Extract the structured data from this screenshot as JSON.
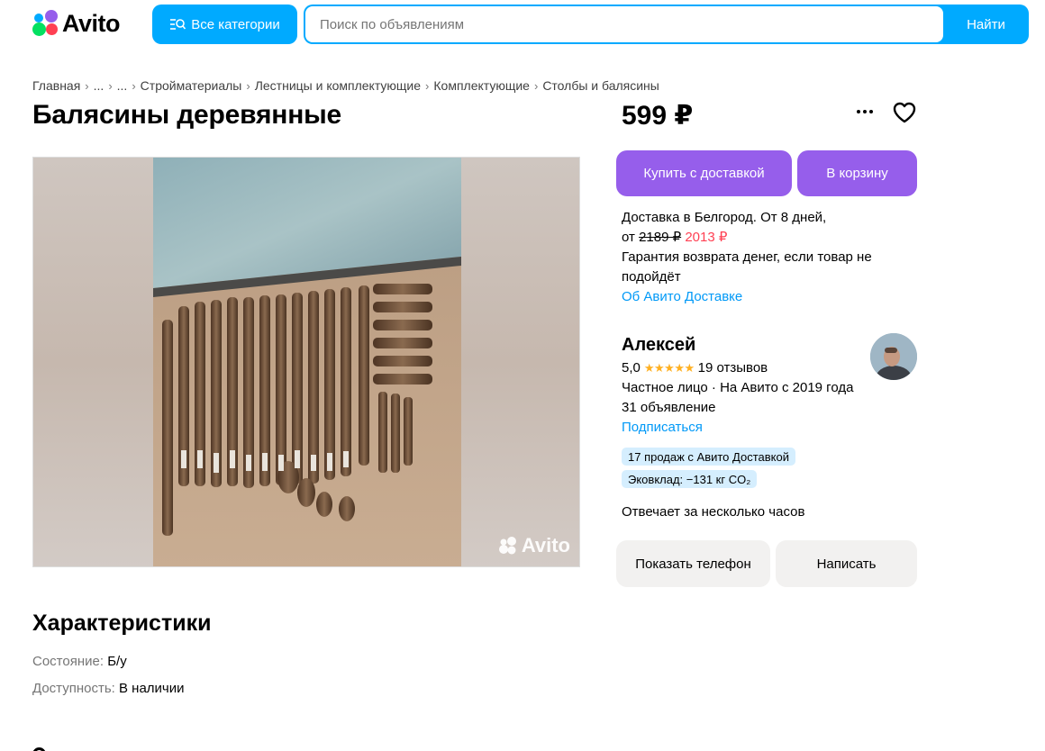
{
  "header": {
    "logo_text": "Avito",
    "categories_label": "Все категории",
    "search_placeholder": "Поиск по объявлениям",
    "search_button": "Найти"
  },
  "breadcrumb": [
    "Главная",
    "...",
    "...",
    "Стройматериалы",
    "Лестницы и комплектующие",
    "Комплектующие",
    "Столбы и балясины"
  ],
  "listing": {
    "title": "Балясины деревянные",
    "price": "599 ₽",
    "watermark": "Avito"
  },
  "actions": {
    "buy_label": "Купить с доставкой",
    "cart_label": "В корзину"
  },
  "delivery": {
    "line1": "Доставка в Белгород. От 8 дней,",
    "from": "от",
    "old_price": "2189 ₽",
    "new_price": "2013 ₽",
    "guarantee": "Гарантия возврата денег, если товар не подойдёт",
    "link": "Об Авито Доставке"
  },
  "seller": {
    "name": "Алексей",
    "rating": "5,0",
    "stars": "★★★★★",
    "reviews": "19 отзывов",
    "type": "Частное лицо · На Авито с 2019 года",
    "ads": "31 объявление",
    "subscribe": "Подписаться",
    "badge_sales": "17 продаж с Авито Доставкой",
    "badge_eco": "Эковклад: −131 кг CO₂",
    "responds": "Отвечает за несколько часов",
    "phone_button": "Показать телефон",
    "write_button": "Написать"
  },
  "characteristics": {
    "title": "Характеристики",
    "condition_label": "Состояние:",
    "condition_value": "Б/у",
    "availability_label": "Доступность:",
    "availability_value": "В наличии"
  },
  "colors": {
    "accent_blue": "#00aaff",
    "accent_purple": "#965eeb",
    "price_red": "#ff4053",
    "link_blue": "#0099f7",
    "star_yellow": "#ffb021",
    "badge_bg": "#d5eefe"
  }
}
